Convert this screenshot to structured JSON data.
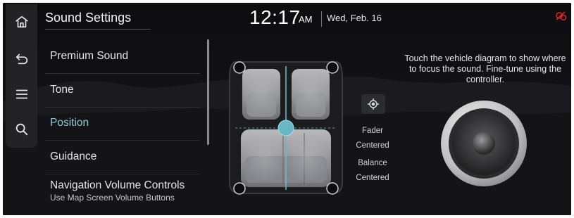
{
  "header": {
    "title": "Sound Settings",
    "time": "12:17",
    "ampm": "AM",
    "date": "Wed, Feb. 16"
  },
  "sidebar": {
    "buttons": [
      {
        "icon": "home-icon"
      },
      {
        "icon": "back-icon"
      },
      {
        "icon": "menu-icon"
      },
      {
        "icon": "search-icon"
      }
    ]
  },
  "menu": {
    "items": [
      {
        "label": "Premium Sound"
      },
      {
        "label": "Tone"
      },
      {
        "label": "Position",
        "active": true
      },
      {
        "label": "Guidance"
      },
      {
        "label": "Navigation Volume Controls",
        "sublabel": "Use Map Screen Volume Buttons"
      }
    ]
  },
  "position": {
    "fader_label": "Fader",
    "fader_value": "Centered",
    "balance_label": "Balance",
    "balance_value": "Centered",
    "instructions": "Touch the vehicle diagram to show where to focus the sound. Fine-tune using the controller."
  },
  "colors": {
    "accent": "#8fc9d3",
    "focus_dot": "#6bb6c4",
    "status_icon": "#d8262e",
    "background": "#0b0b0d"
  }
}
